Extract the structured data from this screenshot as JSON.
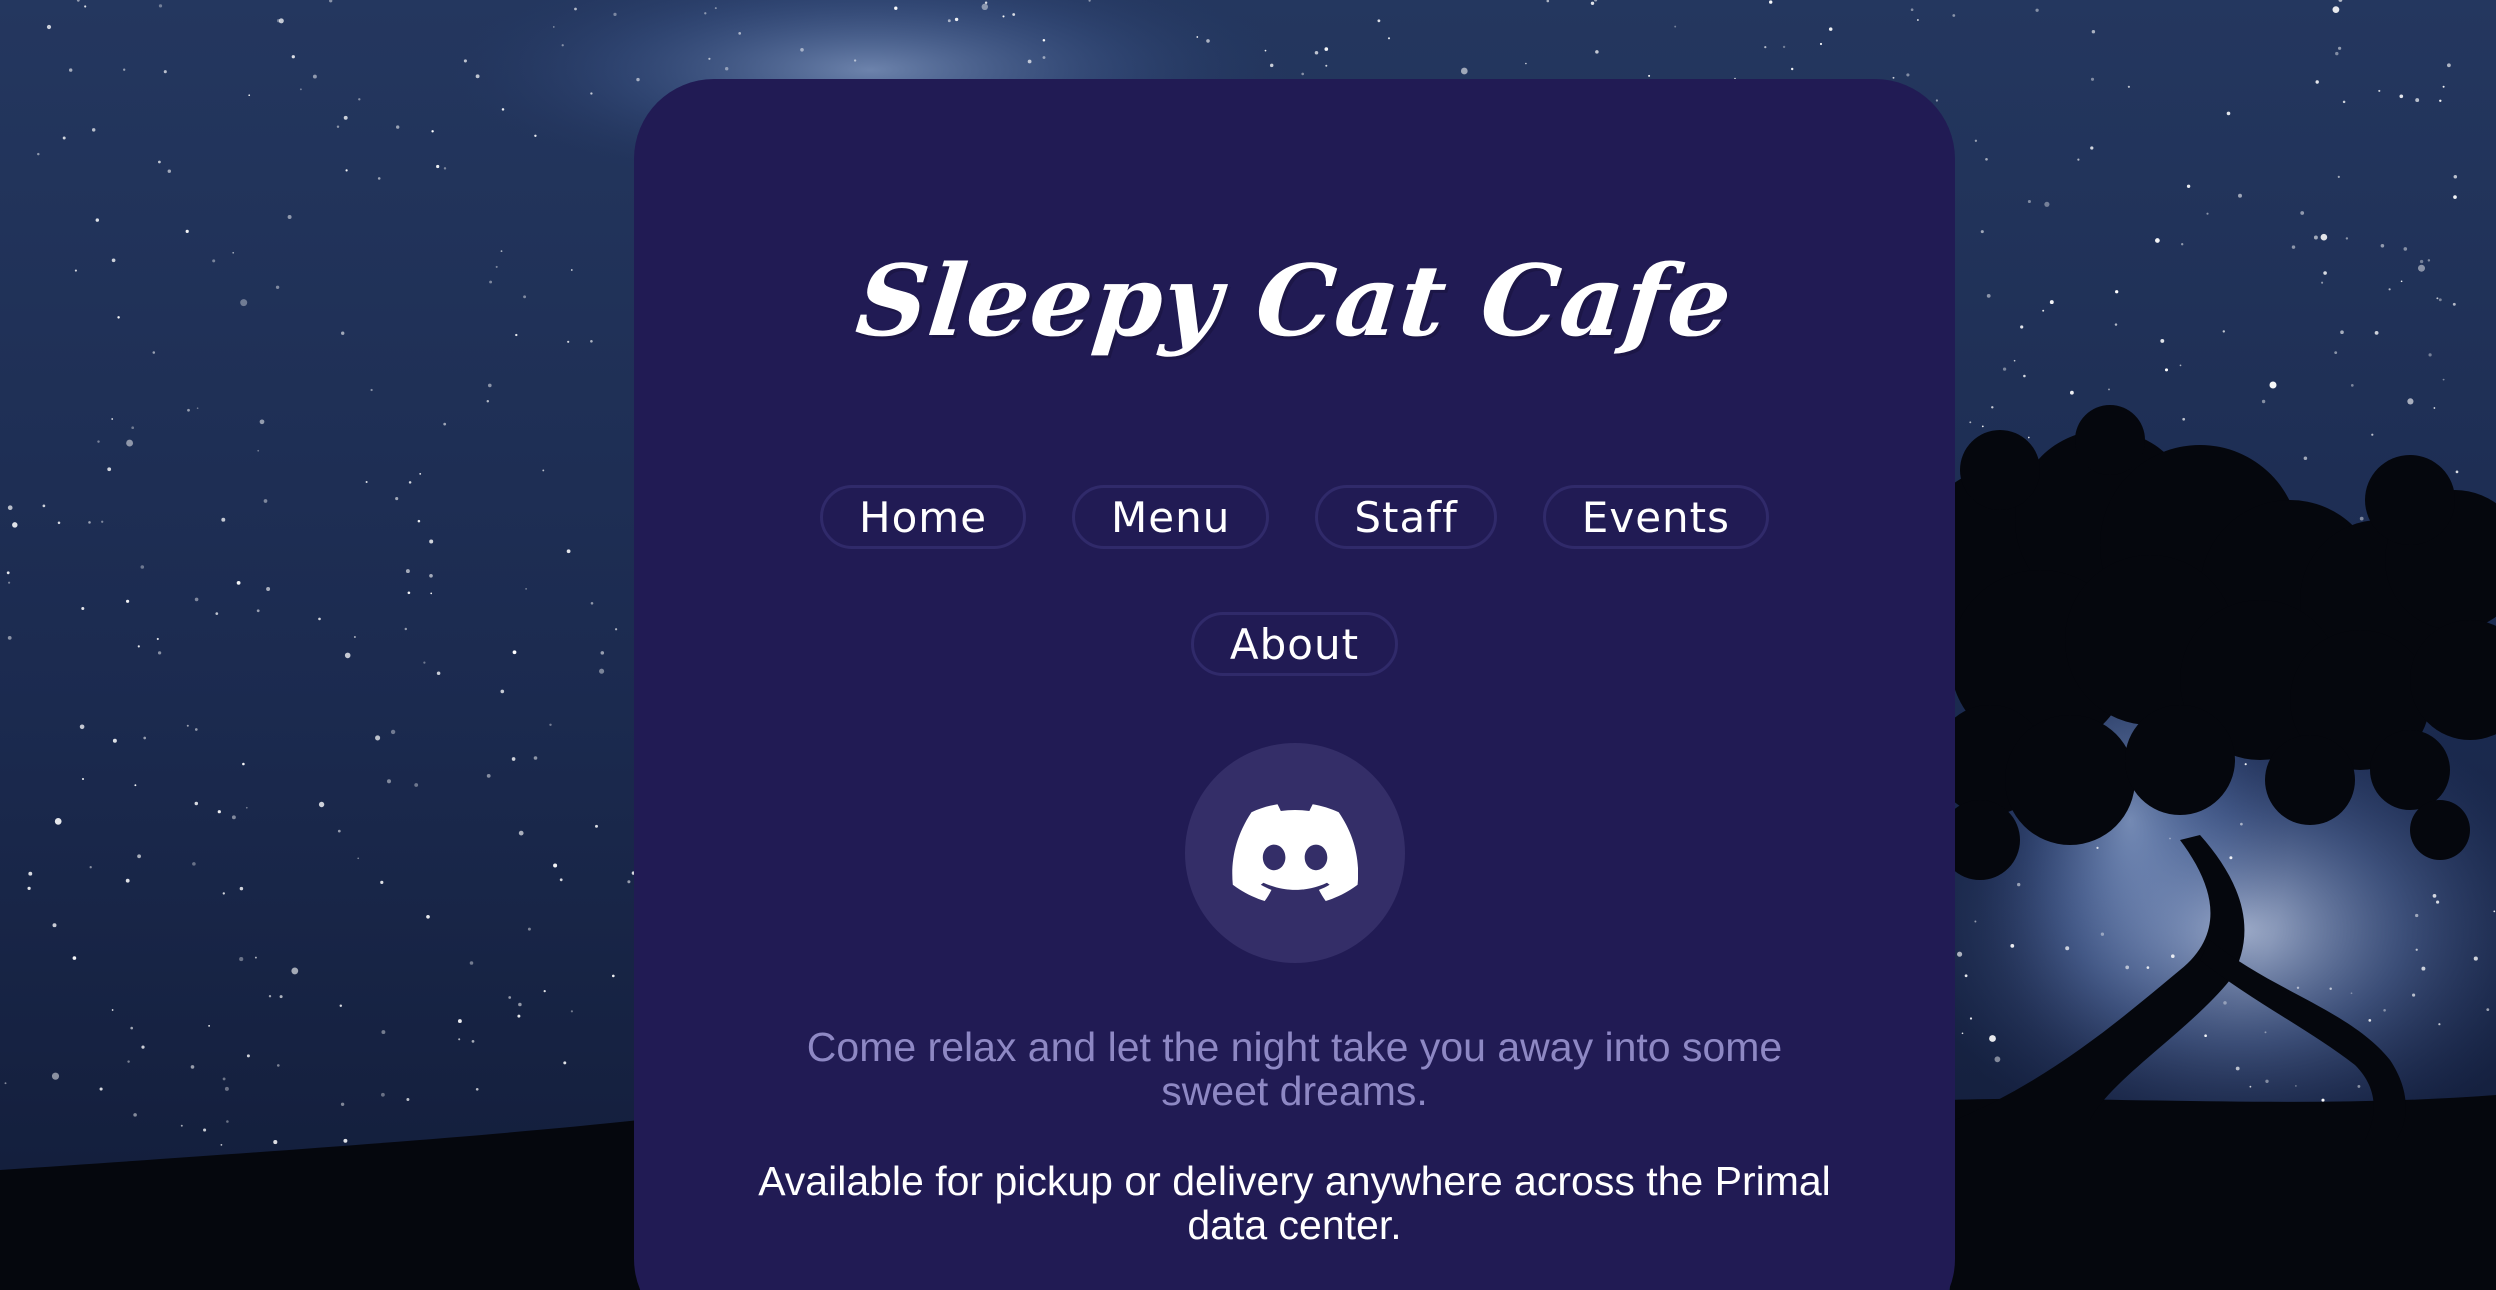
{
  "site": {
    "title": "Sleepy Cat Cafe"
  },
  "nav": {
    "home": "Home",
    "menu": "Menu",
    "staff": "Staff",
    "events": "Events",
    "about": "About"
  },
  "social": {
    "icon": "discord-icon"
  },
  "content": {
    "tagline": "Come relax and let the night take you away into some sweet dreams.",
    "availability": "Available for pickup or delivery anywhere across the Primal data center."
  },
  "colors": {
    "card_background": "#211b54",
    "tagline_text": "#8e88c4",
    "pill_border": "#302a6a",
    "icon_circle": "#342e68"
  }
}
